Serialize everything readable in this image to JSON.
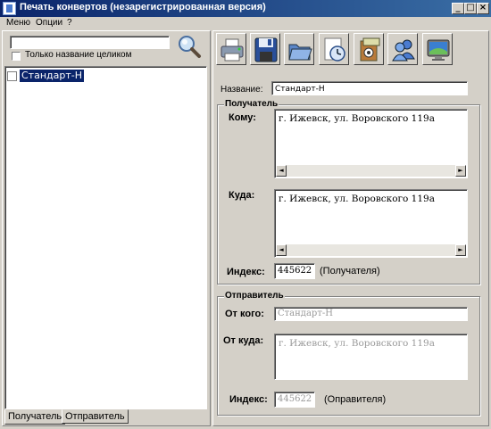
{
  "window": {
    "title": "Печать конвертов (незарегистрированная версия)",
    "controls": [
      "_",
      "□",
      "×"
    ]
  },
  "menu": [
    "Меню",
    "Опции",
    "?"
  ],
  "search": {
    "value": "",
    "whole_name_checkbox_label": "Только название целиком",
    "whole_name_checked": false
  },
  "tree": {
    "items": [
      {
        "label": "Стандарт-Н",
        "selected": true
      }
    ]
  },
  "tabs": [
    {
      "label": "Получатель",
      "active": true
    },
    {
      "label": "Отправитель",
      "active": false
    }
  ],
  "toolbar": {
    "buttons": [
      "printer-icon",
      "floppy-disk-icon",
      "open-folder-icon",
      "clock-icon",
      "settings-icon",
      "users-icon",
      "monitor-icon"
    ]
  },
  "form": {
    "name_label": "Название:",
    "name_value": "Стандарт-Н",
    "recipient": {
      "group_title": "Получатель",
      "to_whom_label": "Кому:",
      "to_whom_value": "г. Ижевск, ул. Воровского 119а",
      "to_where_label": "Куда:",
      "to_where_value": "г. Ижевск, ул. Воровского 119а",
      "index_label": "Индекс:",
      "index_value": "445622",
      "index_note": "(Получателя)"
    },
    "sender": {
      "group_title": "Отправитель",
      "from_whom_label": "От кого:",
      "from_whom_value": "Стандарт-Н",
      "from_where_label": "От куда:",
      "from_where_value": "г. Ижевск, ул. Воровского 119а",
      "index_label": "Индекс:",
      "index_value": "445622",
      "index_note": "(Оправителя)"
    }
  }
}
